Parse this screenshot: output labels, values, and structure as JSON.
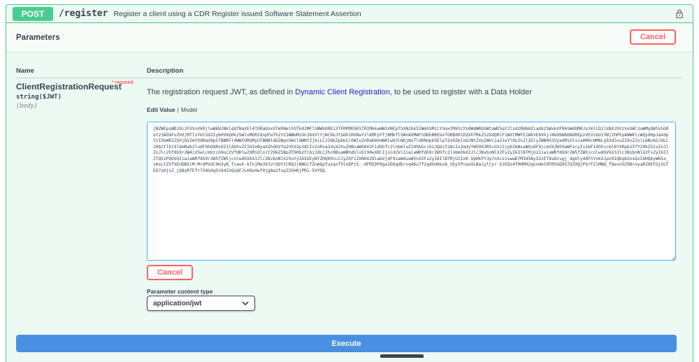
{
  "operation": {
    "method": "POST",
    "path": "/register",
    "summary": "Register a client using a CDR Register issued Software Statement Assertion",
    "lock_icon": "lock-icon"
  },
  "parameters": {
    "title": "Parameters",
    "cancel_label": "Cancel",
    "columns": {
      "name": "Name",
      "description": "Description"
    },
    "param": {
      "name": "ClientRegistrationRequest",
      "required": "* required",
      "type": "string($JWT)",
      "in": "(body)",
      "description_before": "The registration request JWT, as defined in ",
      "description_link": "Dynamic Client Registration",
      "description_after": ", to be used to register with a Data Holder",
      "tab_edit": "Edit Value",
      "tab_sep": "|",
      "tab_model": "Model",
      "value": "jNZWEpsWDJOc2FXVnVkRjlwWkNJNklqQTNaVEl4TORabUxUTmhNelFOTkdJMFl5NWhORE13TFRPME9ESTRIMkkwWW1VNFpTSXNJbk52Wm5SM1lYSmxYMk5zYVdWdWRGOWtaWE5qY2lsd2RHbHZiaUk2SWxkVFR6SWdUM0JsYmlCQ1lXNXJhVzVuSWl3aWMyOWlkSGRoY21WZmFuZHJjMTlsYml5d2IybHVkQ0k2SWloMGRIQnpPaTh2Y2JWWmMzUnJbVVlYjNCbGJtSmhiRXRwY2lkMFpYTjBMbTl5WnkOMWF5ODhNREUxTORBd0lEQXhTRkZSZXdQRlF1WXlMWFE1WkVEbVhjJ4bU9WbDBOREpzVEVzbU1YWjZhMlp4WWklcWQydHpJaXdpYzI5bWRIZGhjbVZmYVdRaU9pSTBNRFl4WWtORGMyUTBNNldGZWpnSWzlOWNYZjkiLCJ2QkZpbm1lOWluZnRabHVmNHlwU3lNbjNxTldKRmpkSElpT2x0Zmlob2NtZVpIWVc1a2JwYl0sInJlZGlyZWN0X3VyaXMiOlsiaHR0cHM6Ly93d3cuZ29vZ2xlLmNvbSJdLCJ0b2tlbl9lbmRwb2ludF9hdXRoX21ldGhvZCI6InByaXZhdGVfa2V5X2p3dCIsInRva2VuX2VuZHBvaW50X2F1dGhfc2lnbmluZ19hbGciOiJQUzI1NiIsImdyYW50X3R5cGVzIjpbImNsaWVudF9jcmVkZW50aWFscyIsImF1dGhvcml6YXRpb25fY29kZSIsInJlZnJlc2hfdG9rZW4iXSwicmVzcG9uc2VfdHlwZXMiOlsiY29kZSBpZF90b2tlbiJdLCJhcHBsaWNhdGlvbl90eXBlIjoid2ViIiwiaWRfdG9rZW5fc2lnbmVkX3Jlc3BvbnNlX2FsZyI6IlBTMjU2IiwiaWRfdG9rZW5fZW5jcnlwdGVkX3Jlc3BvbnNlX2FsZyI6IlJTQS1PQUVQIiwiaWRfdG9rZW5fZW5jcnlwdGVkX3Jlc3BvbnNlX2VuYyI6IkEyNTZHQ00iLCJyZXF1ZXN0X29iamVjdF9zaWduaW5nX2FsZyI6IlBTMjU2In0.OpHkFYJp7nXcvzswwD7M3d5ByIGzET8sDzvgj_dgUly48F5YokXJpn9IQbqbSnsQxIbHQbyWG5x_vmsLtZVfXEnDB5iM-MrdPm3C9m3yB_Tvauh-kTnjMe39JvrQOttCRQ3jNNUcTZnAQpfusqxThloDPzS_-dFMIDP8ga1DOqdbrvq46u7f2qdUU6ks8_VbytPcwoXLNaiylCyr-XJEDs4fHHRH2qnnHe59FR5GQ957QZ0QjPXrFZiMWQ_fQevo5Z9BroyaR28EFGjXLFE67sHjoJ_jQ8yRTEfr7S0Gdq910432QuQFJLK8vHwf0jg8a2fspZ3SH0jPR1-5VYDQ"
    },
    "content_type_label": "Parameter content type",
    "content_type_selected": "application/jwt",
    "execute_label": "Execute"
  }
}
